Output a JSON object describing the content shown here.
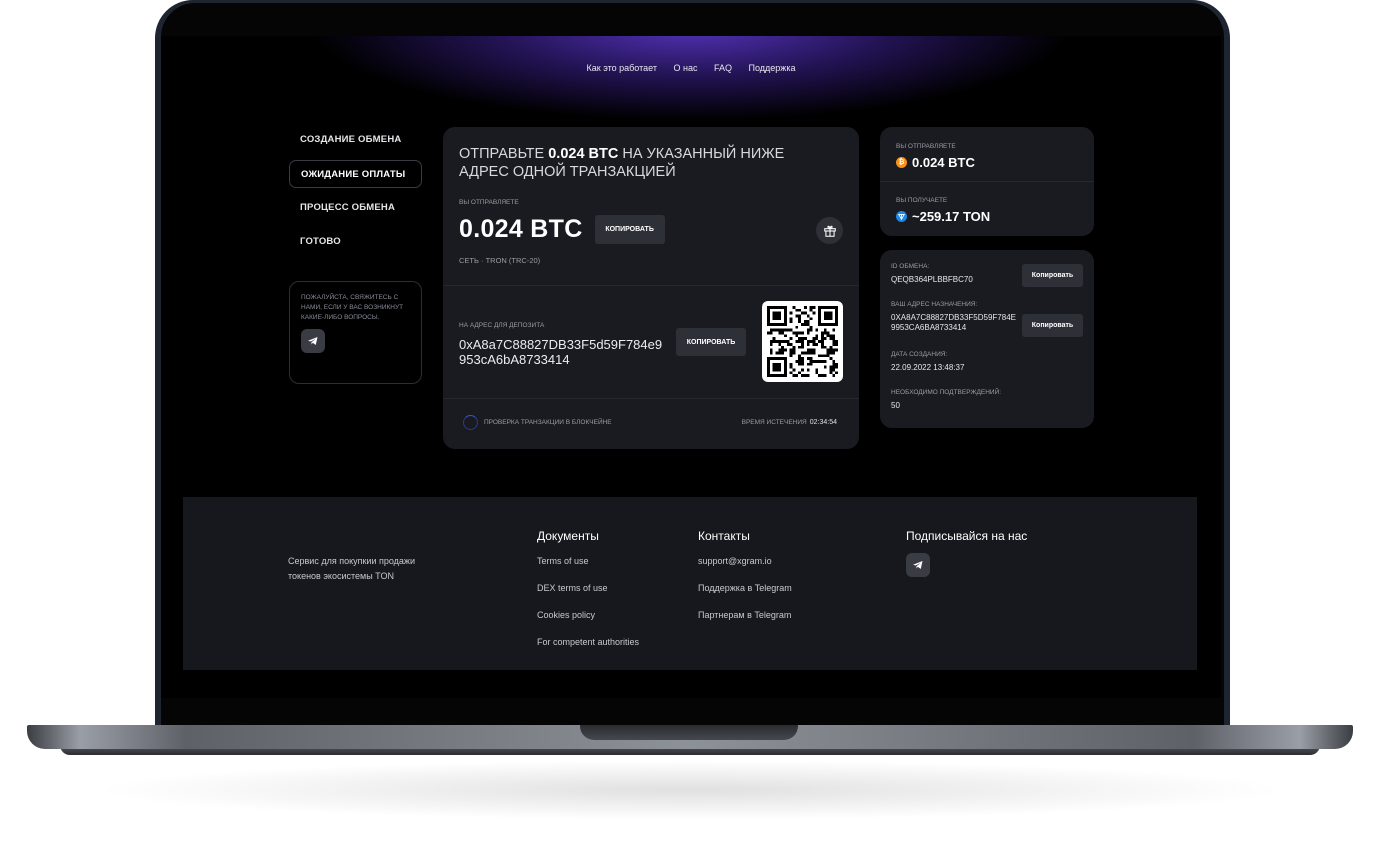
{
  "nav": {
    "items": [
      "Как это работает",
      "О нас",
      "FAQ",
      "Поддержка"
    ]
  },
  "steps": [
    {
      "label": "СОЗДАНИЕ ОБМЕНА",
      "active": false
    },
    {
      "label": "ОЖИДАНИЕ ОПЛАТЫ",
      "active": true
    },
    {
      "label": "ПРОЦЕСС ОБМЕНА",
      "active": false
    },
    {
      "label": "ГОТОВО",
      "active": false
    }
  ],
  "help": {
    "text": "ПОЖАЛУЙСТА, СВЯЖИТЕСЬ С НАМИ, ЕСЛИ У ВАС ВОЗНИКНУТ КАКИЕ-ЛИБО ВОПРОСЫ."
  },
  "main": {
    "title_prefix": "ОТПРАВЬТЕ ",
    "title_amount": "0.024 BTC",
    "title_suffix": " НА УКАЗАННЫЙ НИЖЕ АДРЕС ОДНОЙ ТРАНЗАКЦИЕЙ",
    "send_label": "ВЫ ОТПРАВЛЯЕТЕ",
    "amount": "0.024 BTC",
    "copy_label": "КОПИРОВАТЬ",
    "network": "СЕТЬ · TRON (TRC-20)",
    "deposit_label": "НА АДРЕС ДЛЯ ДЕПОЗИТА",
    "deposit_address": "0xA8a7C88827DB33F5d59F784e9953cA6bA8733414",
    "deposit_copy_label": "КОПИРОВАТЬ",
    "status_text": "ПРОВЕРКА ТРАНЗАКЦИИ В БЛОКЧЕЙНЕ",
    "expiry_label": "ВРЕМЯ ИСТЕЧЕНИЯ",
    "expiry_value": "02:34:54"
  },
  "summary": {
    "send_label": "ВЫ ОТПРАВЛЯЕТЕ",
    "send_value": "0.024 BTC",
    "receive_label": "ВЫ ПОЛУЧАЕТЕ",
    "receive_value": "~259.17 TON",
    "btc_color": "#f7931a",
    "ton_color": "#1e88e5"
  },
  "details": {
    "id_label": "ID ОБМЕНА:",
    "id_value": "QEQB364PLBBFBC70",
    "id_copy": "Копировать",
    "dest_label": "ВАШ АДРЕС НАЗНАЧЕНИЯ:",
    "dest_value": "0XA8A7C88827DB33F5D59F784E9953CA6BA8733414",
    "dest_copy": "Копировать",
    "date_label": "ДАТА СОЗДАНИЯ:",
    "date_value": "22.09.2022 13:48:37",
    "conf_label": "НЕОБХОДИМО ПОДТВЕРЖДЕНИЙ:",
    "conf_value": "50"
  },
  "footer": {
    "description": "Сервис для покупкии продажи токенов экосистемы TON",
    "docs": {
      "heading": "Документы",
      "links": [
        "Terms of use",
        "DEX terms of use",
        "Cookies policy",
        "For competent authorities"
      ]
    },
    "contacts": {
      "heading": "Контакты",
      "links": [
        "support@xgram.io",
        "Поддержка в Telegram",
        "Партнерам в Telegram"
      ]
    },
    "social": {
      "heading": "Подписывайся на нас"
    }
  }
}
